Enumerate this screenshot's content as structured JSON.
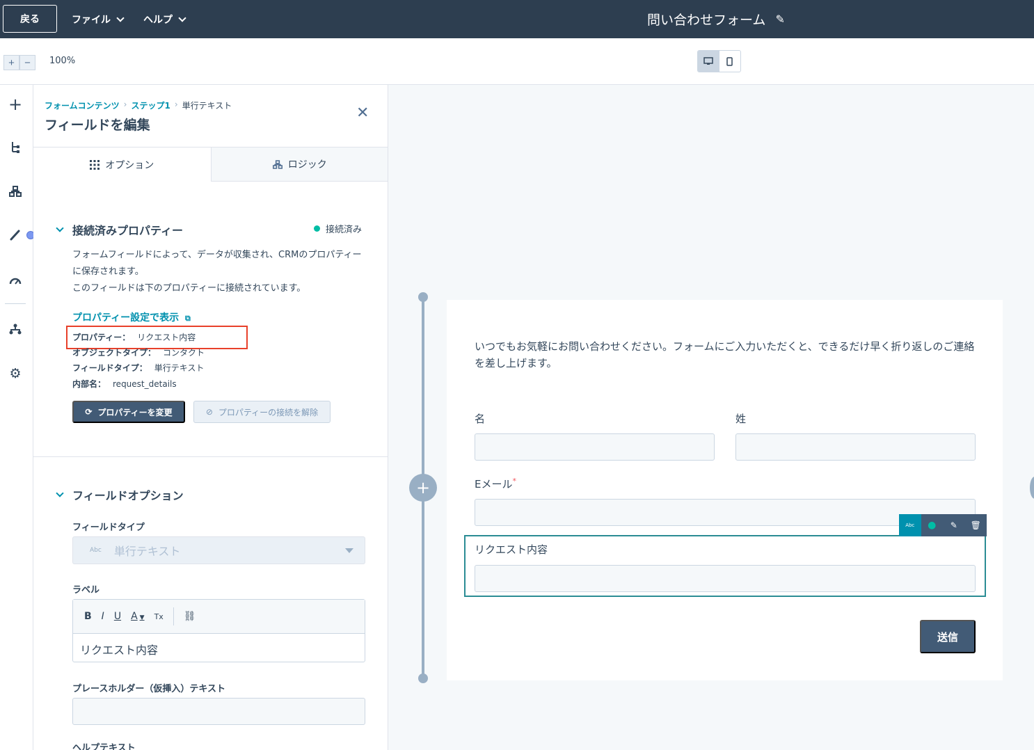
{
  "topbar": {
    "back_label": "戻る",
    "menu_file": "ファイル",
    "menu_help": "ヘルプ",
    "form_title": "問い合わせフォーム"
  },
  "zoom": {
    "plus": "+",
    "minus": "−",
    "level": "100%"
  },
  "panel": {
    "breadcrumb": [
      "フォームコンテンツ",
      "ステップ1",
      "単行テキスト"
    ],
    "title": "フィールドを編集",
    "tabs": [
      {
        "label": "オプション",
        "active": true
      },
      {
        "label": "ロジック",
        "active": false
      }
    ],
    "connected": {
      "heading": "接続済みプロパティー",
      "status": "接続済み",
      "description": "フォームフィールドによって、データが収集され、CRMのプロパティーに保存されます。",
      "description2": "このフィールドは下のプロパティーに接続されています。",
      "view_link": "プロパティー設定で表示",
      "rows": [
        {
          "key": "プロパティー：",
          "value": "リクエスト内容"
        },
        {
          "key": "オブジェクトタイプ：",
          "value": "コンタクト"
        },
        {
          "key": "フィールドタイプ：",
          "value": "単行テキスト"
        },
        {
          "key": "内部名：",
          "value": "request_details"
        }
      ],
      "change_button": "プロパティーを変更",
      "disconnect_button": "プロパティーの接続を解除"
    },
    "field_options": {
      "heading": "フィールドオプション",
      "type_label": "フィールドタイプ",
      "type_icon_text": "Abc",
      "type_value": "単行テキスト",
      "label_label": "ラベル",
      "label_value": "リクエスト内容",
      "toolbar": {
        "bold": "B",
        "italic": "I",
        "underline": "U",
        "color": "A",
        "clear": "Tx"
      },
      "placeholder_label": "プレースホルダー（仮挿入）テキスト",
      "help_label": "ヘルプテキスト"
    }
  },
  "form": {
    "intro": "いつでもお気軽にお問い合わせください。フォームにご入力いただくと、できるだけ早く折り返しのご連絡を差し上げます。",
    "first_name_label": "名",
    "last_name_label": "姓",
    "email_label": "Eメール",
    "required_mark": "*",
    "request_label": "リクエスト内容",
    "field_toolbar_abc": "Abc",
    "submit_label": "送信"
  },
  "colors": {
    "topbar": "#2d3e50",
    "accent": "#0091ae",
    "connected_dot": "#00bda5",
    "highlight": "#e8402a",
    "button_dark": "#425b76"
  }
}
